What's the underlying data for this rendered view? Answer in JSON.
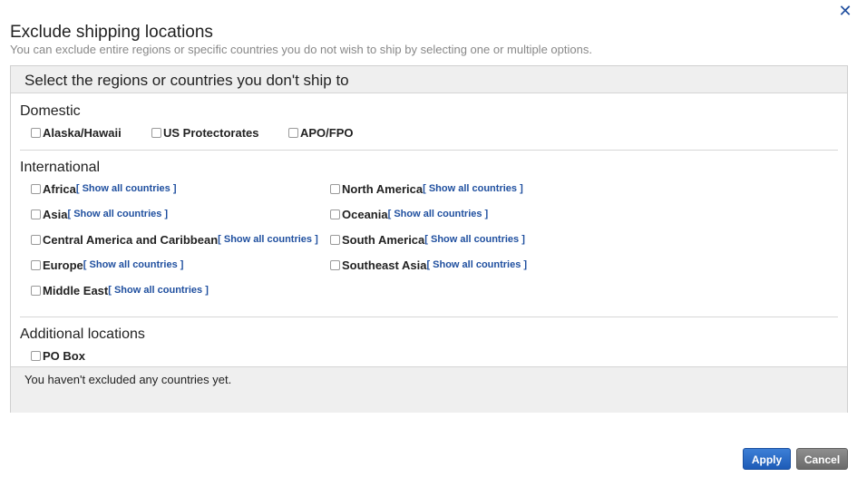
{
  "dialog": {
    "close_glyph": "✕",
    "title": "Exclude shipping locations",
    "subtitle": "You can exclude entire regions or specific countries you do not wish to ship by selecting one or multiple options."
  },
  "panel": {
    "header": "Select the regions or countries you don't ship to",
    "domestic": {
      "title": "Domestic",
      "options": [
        "Alaska/Hawaii",
        "US Protectorates",
        "APO/FPO"
      ]
    },
    "international": {
      "title": "International",
      "show_link": "[ Show all countries ]",
      "regions": [
        "Africa",
        "Asia",
        "Central America and Caribbean",
        "Europe",
        "Middle East",
        "North America",
        "Oceania",
        "South America",
        "Southeast Asia"
      ]
    },
    "additional": {
      "title": "Additional locations",
      "options": [
        "PO Box"
      ]
    },
    "status": "You haven't excluded any countries yet."
  },
  "buttons": {
    "apply": "Apply",
    "cancel": "Cancel"
  },
  "colors": {
    "link": "#1f4f9f",
    "apply": "#2a6cc8",
    "cancel": "#7a7a7a",
    "header_bg": "#efefef"
  }
}
